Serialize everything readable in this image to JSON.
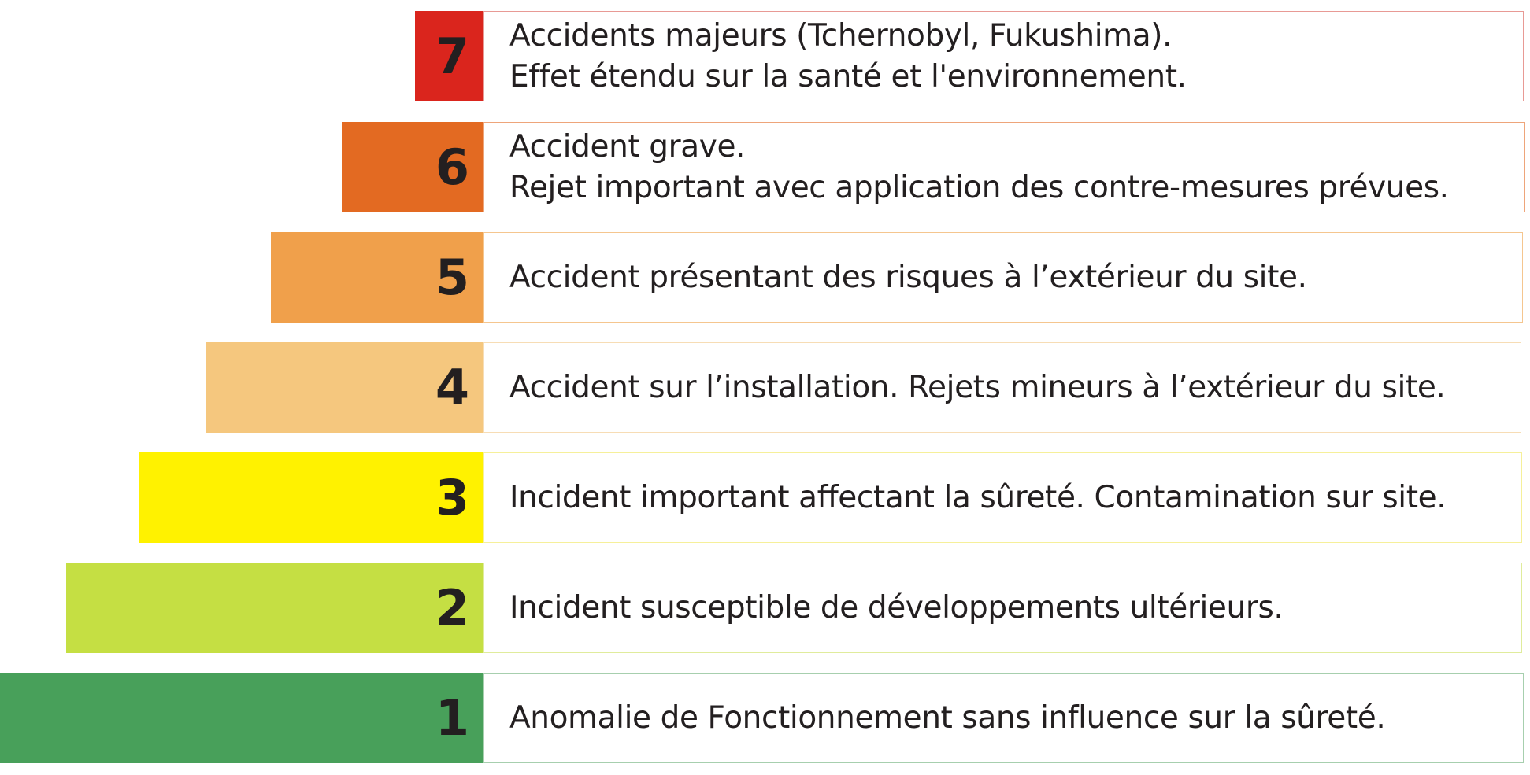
{
  "levels": [
    {
      "number": "7",
      "lines": [
        "Accidents majeurs (Tchernobyl, Fukushima).",
        "Effet étendu sur la santé et l'environnement."
      ],
      "color": "#da251d",
      "border_color": "#e89a95"
    },
    {
      "number": "6",
      "lines": [
        "Accident grave.",
        "Rejet important  avec application des contre-mesures prévues."
      ],
      "color": "#e36a22",
      "border_color": "#eea57a"
    },
    {
      "number": "5",
      "lines": [
        "Accident présentant des risques à l’extérieur du site."
      ],
      "color": "#f0a04b",
      "border_color": "#f5c68f"
    },
    {
      "number": "4",
      "lines": [
        "Accident sur l’installation. Rejets mineurs à l’extérieur du site."
      ],
      "color": "#f5c77e",
      "border_color": "#f7ddb5"
    },
    {
      "number": "3",
      "lines": [
        "Incident important affectant la sûreté. Contamination sur site."
      ],
      "color": "#fff200",
      "border_color": "#f6f09a"
    },
    {
      "number": "2",
      "lines": [
        "Incident susceptible de développements ultérieurs."
      ],
      "color": "#c5df43",
      "border_color": "#e0ec9c"
    },
    {
      "number": "1",
      "lines": [
        "Anomalie de Fonctionnement sans influence sur la sûreté."
      ],
      "color": "#48a05a",
      "border_color": "#a7cfae"
    }
  ]
}
